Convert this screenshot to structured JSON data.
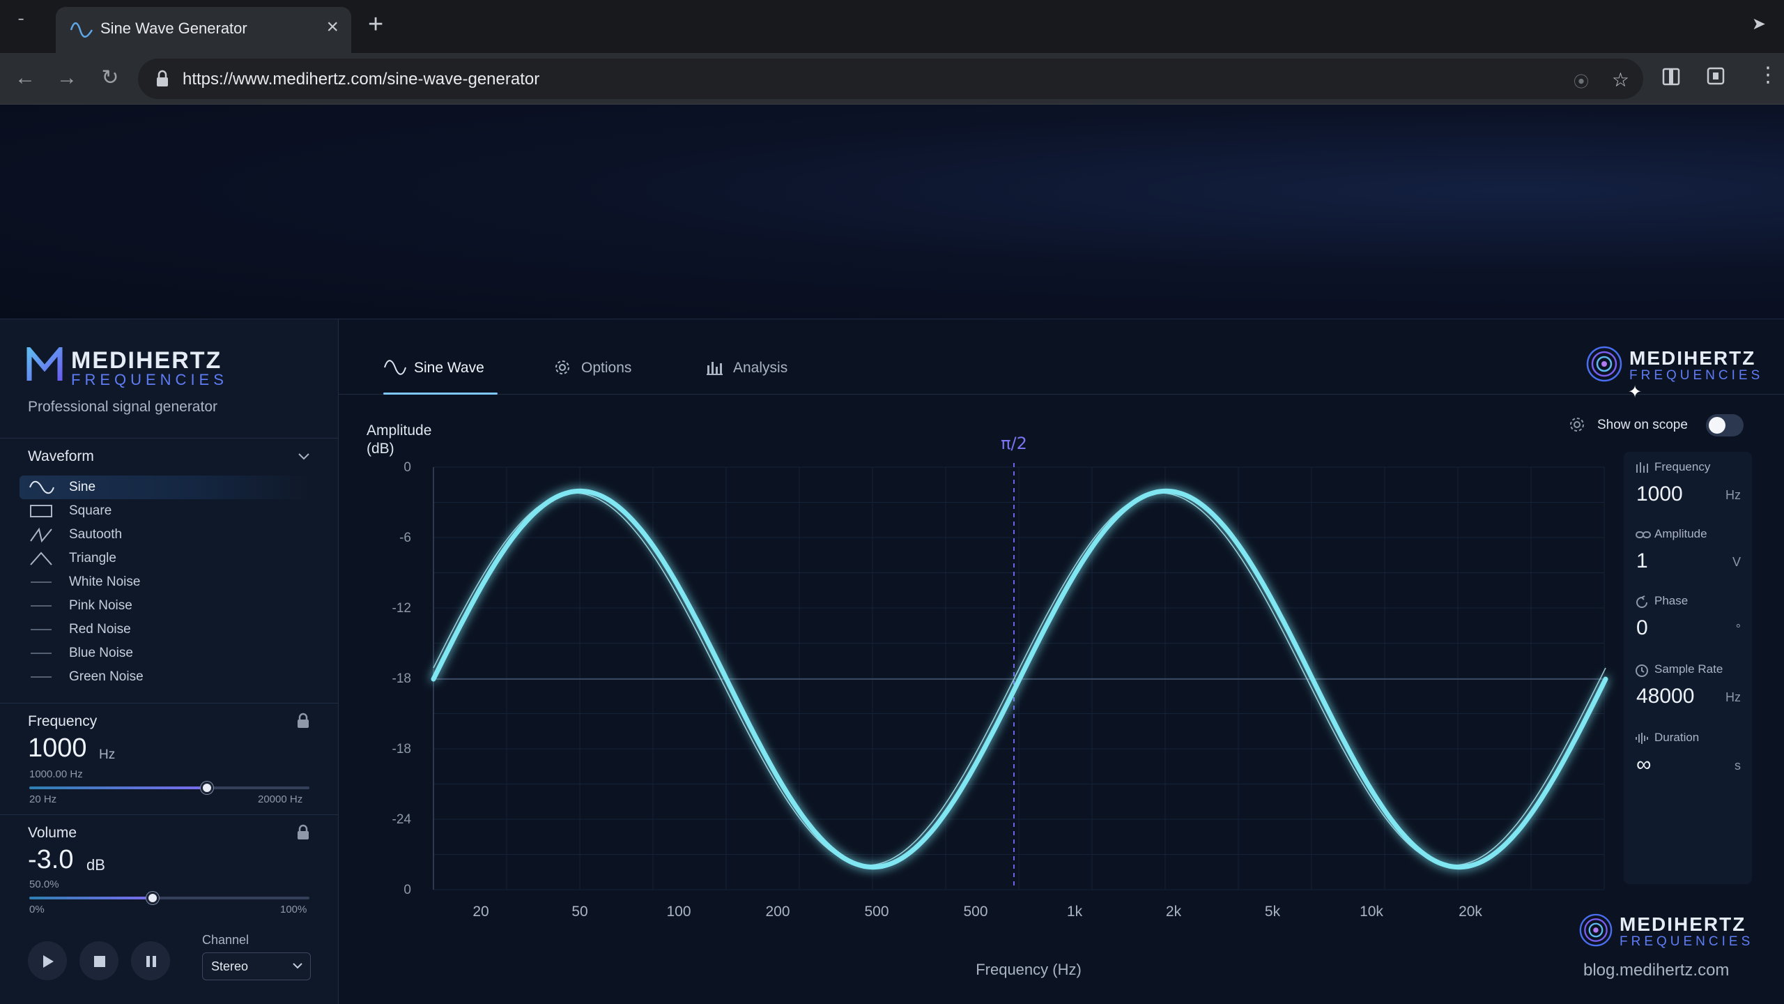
{
  "browser": {
    "tab_title": "Sine Wave Generator",
    "url": "https://www.medihertz.com/sine-wave-generator"
  },
  "sidebar": {
    "brand_name": "MEDIHERTZ",
    "brand_sub": "FREQUENCIES",
    "tagline": "Professional signal generator",
    "waveform_title": "Waveform",
    "waveforms": [
      {
        "label": "Sine",
        "icon": "sine-icon",
        "active": true
      },
      {
        "label": "Square",
        "icon": "square-icon",
        "active": false
      },
      {
        "label": "Sautooth",
        "icon": "sawtooth-icon",
        "active": false
      },
      {
        "label": "Triangle",
        "icon": "triangle-icon",
        "active": false
      },
      {
        "label": "White Noise",
        "icon": "line-icon",
        "active": false
      },
      {
        "label": "Pink Noise",
        "icon": "line-icon",
        "active": false
      },
      {
        "label": "Red Noise",
        "icon": "line-icon",
        "active": false
      },
      {
        "label": "Blue Noise",
        "icon": "line-icon",
        "active": false
      },
      {
        "label": "Green Noise",
        "icon": "line-icon",
        "active": false
      }
    ],
    "frequency": {
      "title": "Frequency",
      "value": "1000",
      "unit": "Hz",
      "precise": "1000.00 Hz",
      "min_label": "20 Hz",
      "max_label": "20000 Hz",
      "slider_fraction": 0.634
    },
    "volume": {
      "title": "Volume",
      "value": "-3.0",
      "unit": "dB",
      "percent": "50.0%",
      "min_label": "0%",
      "max_label": "100%",
      "slider_fraction": 0.44
    },
    "channel": {
      "label": "Channel",
      "value": "Stereo"
    }
  },
  "main": {
    "tabs": [
      {
        "label": "Sine Wave",
        "icon": "sine-icon",
        "active": true
      },
      {
        "label": "Options",
        "icon": "gear-icon",
        "active": false
      },
      {
        "label": "Analysis",
        "icon": "bar-chart-icon",
        "active": false
      }
    ],
    "logo_name": "MEDIHERTZ",
    "logo_sub": "FREQUENCIES",
    "show_on_scope_label": "Show on scope",
    "show_on_scope": false,
    "marker_label": "π/2",
    "params": [
      {
        "label": "Frequency",
        "value": "1000",
        "unit": "Hz",
        "icon": "bars-icon"
      },
      {
        "label": "Amplitude",
        "value": "1",
        "unit": "V",
        "icon": "link-icon"
      },
      {
        "label": "Phase",
        "value": "0",
        "unit": "°",
        "icon": "phase-icon"
      },
      {
        "label": "Sample Rate",
        "value": "48000",
        "unit": "Hz",
        "icon": "clock-icon"
      },
      {
        "label": "Duration",
        "value": "∞",
        "unit": "s",
        "icon": "waveform-icon"
      }
    ],
    "blog_link": "blog.medihertz.com"
  },
  "chart_data": {
    "type": "line",
    "ylabel": "Amplitude\n(dB)",
    "xlabel": "Frequency (Hz)",
    "y_ticks": [
      "0",
      "-6",
      "-12",
      "-18",
      "-18",
      "-24",
      "0"
    ],
    "x_ticks": [
      "20",
      "50",
      "100",
      "200",
      "500",
      "500",
      "1k",
      "2k",
      "5k",
      "10k",
      "20k"
    ],
    "series": [
      {
        "cycles": 2,
        "amplitude": 1,
        "phase_deg": 0
      }
    ],
    "grid": true,
    "colors": {
      "wave": "#7fe6f2",
      "marker": "#6b63e8"
    }
  }
}
